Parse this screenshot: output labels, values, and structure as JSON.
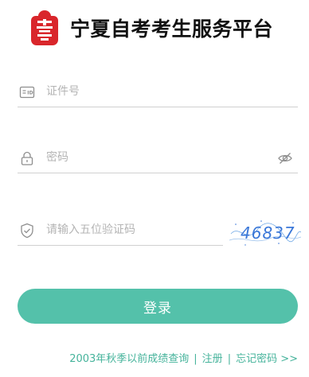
{
  "header": {
    "title": "宁夏自考考生服务平台",
    "logo_icon": "seal-logo-icon"
  },
  "form": {
    "id_placeholder": "证件号",
    "password_placeholder": "密码",
    "captcha_placeholder": "请输入五位验证码",
    "captcha_text": "46837",
    "login_label": "登录"
  },
  "footer": {
    "query_link": "2003年秋季以前成绩查询",
    "separator": "|",
    "register_link": "注册",
    "forgot_link": "忘记密码 >>"
  },
  "colors": {
    "accent": "#54c1aa",
    "link": "#45b39b",
    "logo_red": "#d9262b"
  }
}
